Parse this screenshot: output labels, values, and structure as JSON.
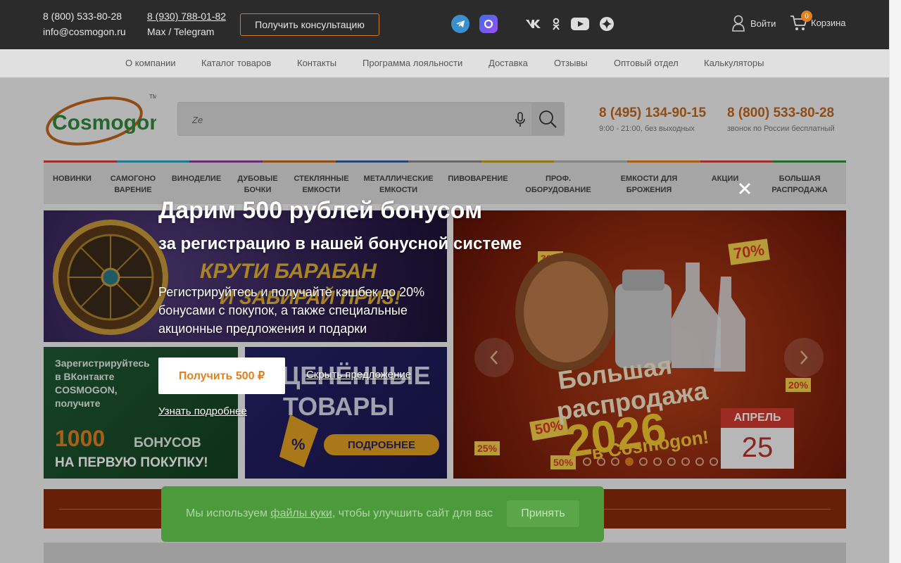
{
  "topbar": {
    "phone1": "8 (800) 533-80-28",
    "email": "info@cosmogon.ru",
    "phone2": "8 (930) 788-01-82",
    "messenger": "Max / Telegram",
    "consult_label": "Получить консультацию",
    "login_label": "Войти",
    "cart_label": "Корзина",
    "cart_count": "0"
  },
  "subnav": [
    "О компании",
    "Каталог товаров",
    "Контакты",
    "Программа лояльности",
    "Доставка",
    "Отзывы",
    "Оптовый отдел",
    "Калькуляторы"
  ],
  "logo": {
    "text": "Cosmogon.ru",
    "tm": "TM"
  },
  "search": {
    "value": "Ze"
  },
  "phones": [
    {
      "number": "8 (495) 134-90-15",
      "note": "9:00 - 21:00, без выходных"
    },
    {
      "number": "8 (800) 533-80-28",
      "note": "звонок по России бесплатный"
    }
  ],
  "categories": [
    {
      "l1": "НОВИНКИ",
      "l2": ""
    },
    {
      "l1": "САМОГОНО",
      "l2": "ВАРЕНИЕ"
    },
    {
      "l1": "ВИНОДЕЛИЕ",
      "l2": ""
    },
    {
      "l1": "ДУБОВЫЕ",
      "l2": "БОЧКИ"
    },
    {
      "l1": "СТЕКЛЯННЫЕ",
      "l2": "ЕМКОСТИ"
    },
    {
      "l1": "МЕТАЛЛИЧЕСКИЕ",
      "l2": "ЕМКОСТИ"
    },
    {
      "l1": "ПИВОВАРЕНИЕ",
      "l2": ""
    },
    {
      "l1": "ПРОФ.",
      "l2": "ОБОРУДОВАНИЕ"
    },
    {
      "l1": "ЕМКОСТИ ДЛЯ",
      "l2": "БРОЖЕНИЯ"
    },
    {
      "l1": "АКЦИИ",
      "l2": ""
    },
    {
      "l1": "БОЛЬШАЯ",
      "l2": "РАСПРОДАЖА"
    }
  ],
  "banners": {
    "wheel": {
      "line1": "КРУТИ БАРАБАН",
      "line2": "И ЗАБИРАЙ ПРИЗ!"
    },
    "vk": {
      "text1": "Зарегистрируйтесь",
      "text2": "в ВКонтакте",
      "text3": "COSMOGON,",
      "text4": "получите",
      "big": "1000",
      "big2": "БОНУСОВ",
      "footer": "НА ПЕРВУЮ ПОКУПКУ!"
    },
    "goods": {
      "line1": "ЦЕНЁННЫЕ",
      "line2": "ТОВАРЫ",
      "btn": "ПОДРОБНЕЕ"
    },
    "sale": {
      "line1": "Большая",
      "line2": "распродажа",
      "year": "2026",
      "brand": "в Cosmogon!",
      "month": "АПРЕЛЬ",
      "day": "25",
      "pct1": "70%",
      "pct2": "50%",
      "pct3": "25%",
      "pct4": "20%",
      "pct5": "30%",
      "pct6": "50%"
    }
  },
  "popup": {
    "title": "Дарим 500 рублей бонусом",
    "subtitle": "за регистрацию в нашей бонусной системе",
    "description": "Регистрируйтесь и получайте кэшбек до 20% бонусами с покупок, а также специальные акционные предложения и подарки",
    "cta_label": "Получить 500 ₽",
    "hide_label": "Скрыть предложение",
    "more_label": "Узнать подробнее"
  },
  "cookie": {
    "text_before": "Мы используем ",
    "link": "файлы куки",
    "text_after": ", чтобы улучшить сайт для вас",
    "accept_label": "Принять"
  },
  "colors": {
    "accent": "#e2801e",
    "topbar": "#2b2b2b",
    "cookie": "#4d9a3c"
  }
}
